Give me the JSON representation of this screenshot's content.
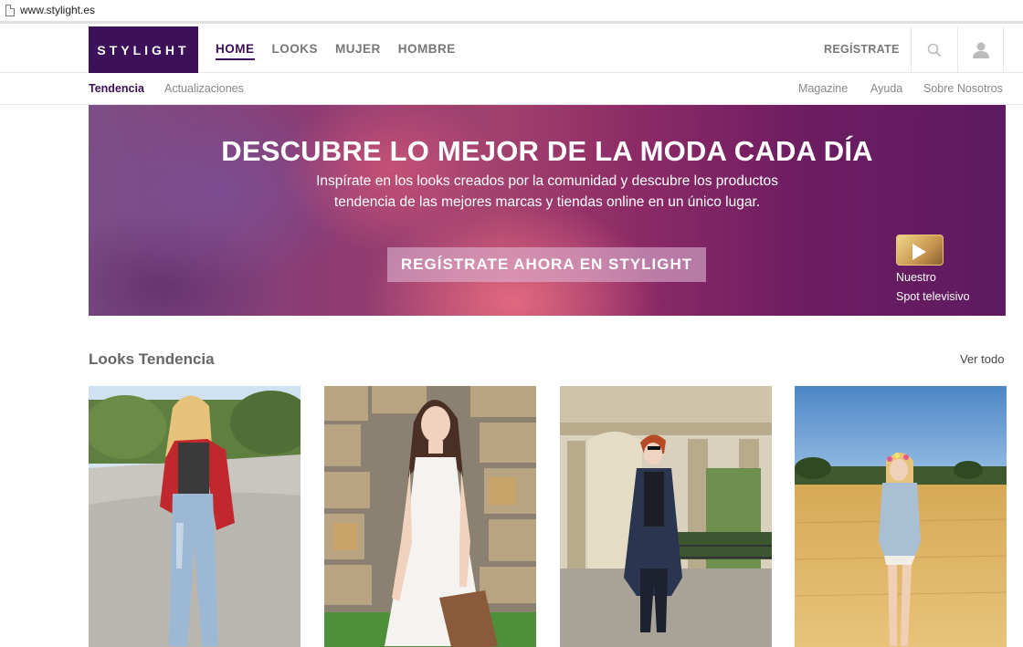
{
  "browser": {
    "url": "www.stylight.es"
  },
  "header": {
    "logo": "STYLIGHT",
    "nav": [
      "HOME",
      "LOOKS",
      "MUJER",
      "HOMBRE"
    ],
    "register": "REGÍSTRATE"
  },
  "subnav": {
    "left": [
      "Tendencia",
      "Actualizaciones"
    ],
    "right": [
      "Magazine",
      "Ayuda",
      "Sobre Nosotros"
    ]
  },
  "hero": {
    "title": "DESCUBRE LO MEJOR DE LA MODA CADA DÍA",
    "subtitle": "Inspírate en los looks creados por la comunidad y descubre los productos tendencia de las mejores marcas y tiendas online en un único lugar.",
    "cta": "REGÍSTRATE AHORA EN STYLIGHT",
    "video_line1": "Nuestro",
    "video_line2": "Spot televisivo"
  },
  "section": {
    "title": "Looks Tendencia",
    "see_all": "Ver todo"
  },
  "icons": {
    "search": "search-icon",
    "user": "user-icon",
    "play": "play-icon",
    "page": "page-icon"
  },
  "colors": {
    "brand": "#3c1159",
    "muted": "#777777"
  }
}
